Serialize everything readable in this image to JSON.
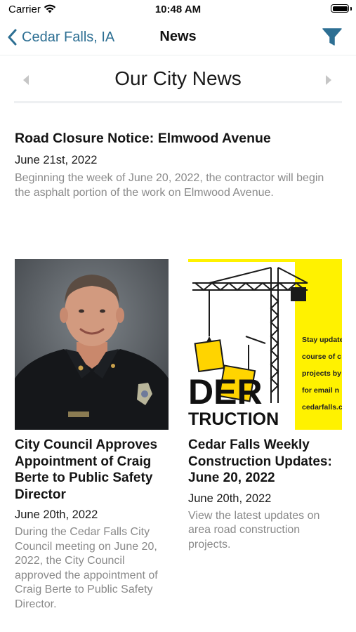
{
  "status_bar": {
    "carrier": "Carrier",
    "time": "10:48 AM",
    "battery_level": 1.0
  },
  "nav": {
    "back_label": "Cedar Falls, IA",
    "title": "News",
    "filter_icon": "filter-icon",
    "accent_color": "#2d6f93"
  },
  "section": {
    "title": "Our City News"
  },
  "featured": {
    "headline": "Road Closure Notice: Elmwood Avenue",
    "date": "June 21st, 2022",
    "summary": "Beginning the week of June 20, 2022, the contractor will begin the asphalt portion of the work on Elmwood Avenue."
  },
  "cards": [
    {
      "headline": "City Council Approves Appointment of Craig Berte to Public Safety Director",
      "date": "June 20th, 2022",
      "summary": "During the Cedar Falls City Council meeting on June 20, 2022, the City Council approved the appointment of Craig Berte to Public Safety Director."
    },
    {
      "headline": "Cedar Falls Weekly Construction Updates: June 20, 2022",
      "date": "June 20th, 2022",
      "summary": "View the latest updates on area road construction projects.",
      "image": {
        "text_block": "DER",
        "text_band": "TRUCTION",
        "side_lines": [
          "Stay update",
          "course of c",
          "projects by",
          "for email n",
          "cedarfalls.c"
        ]
      }
    }
  ]
}
